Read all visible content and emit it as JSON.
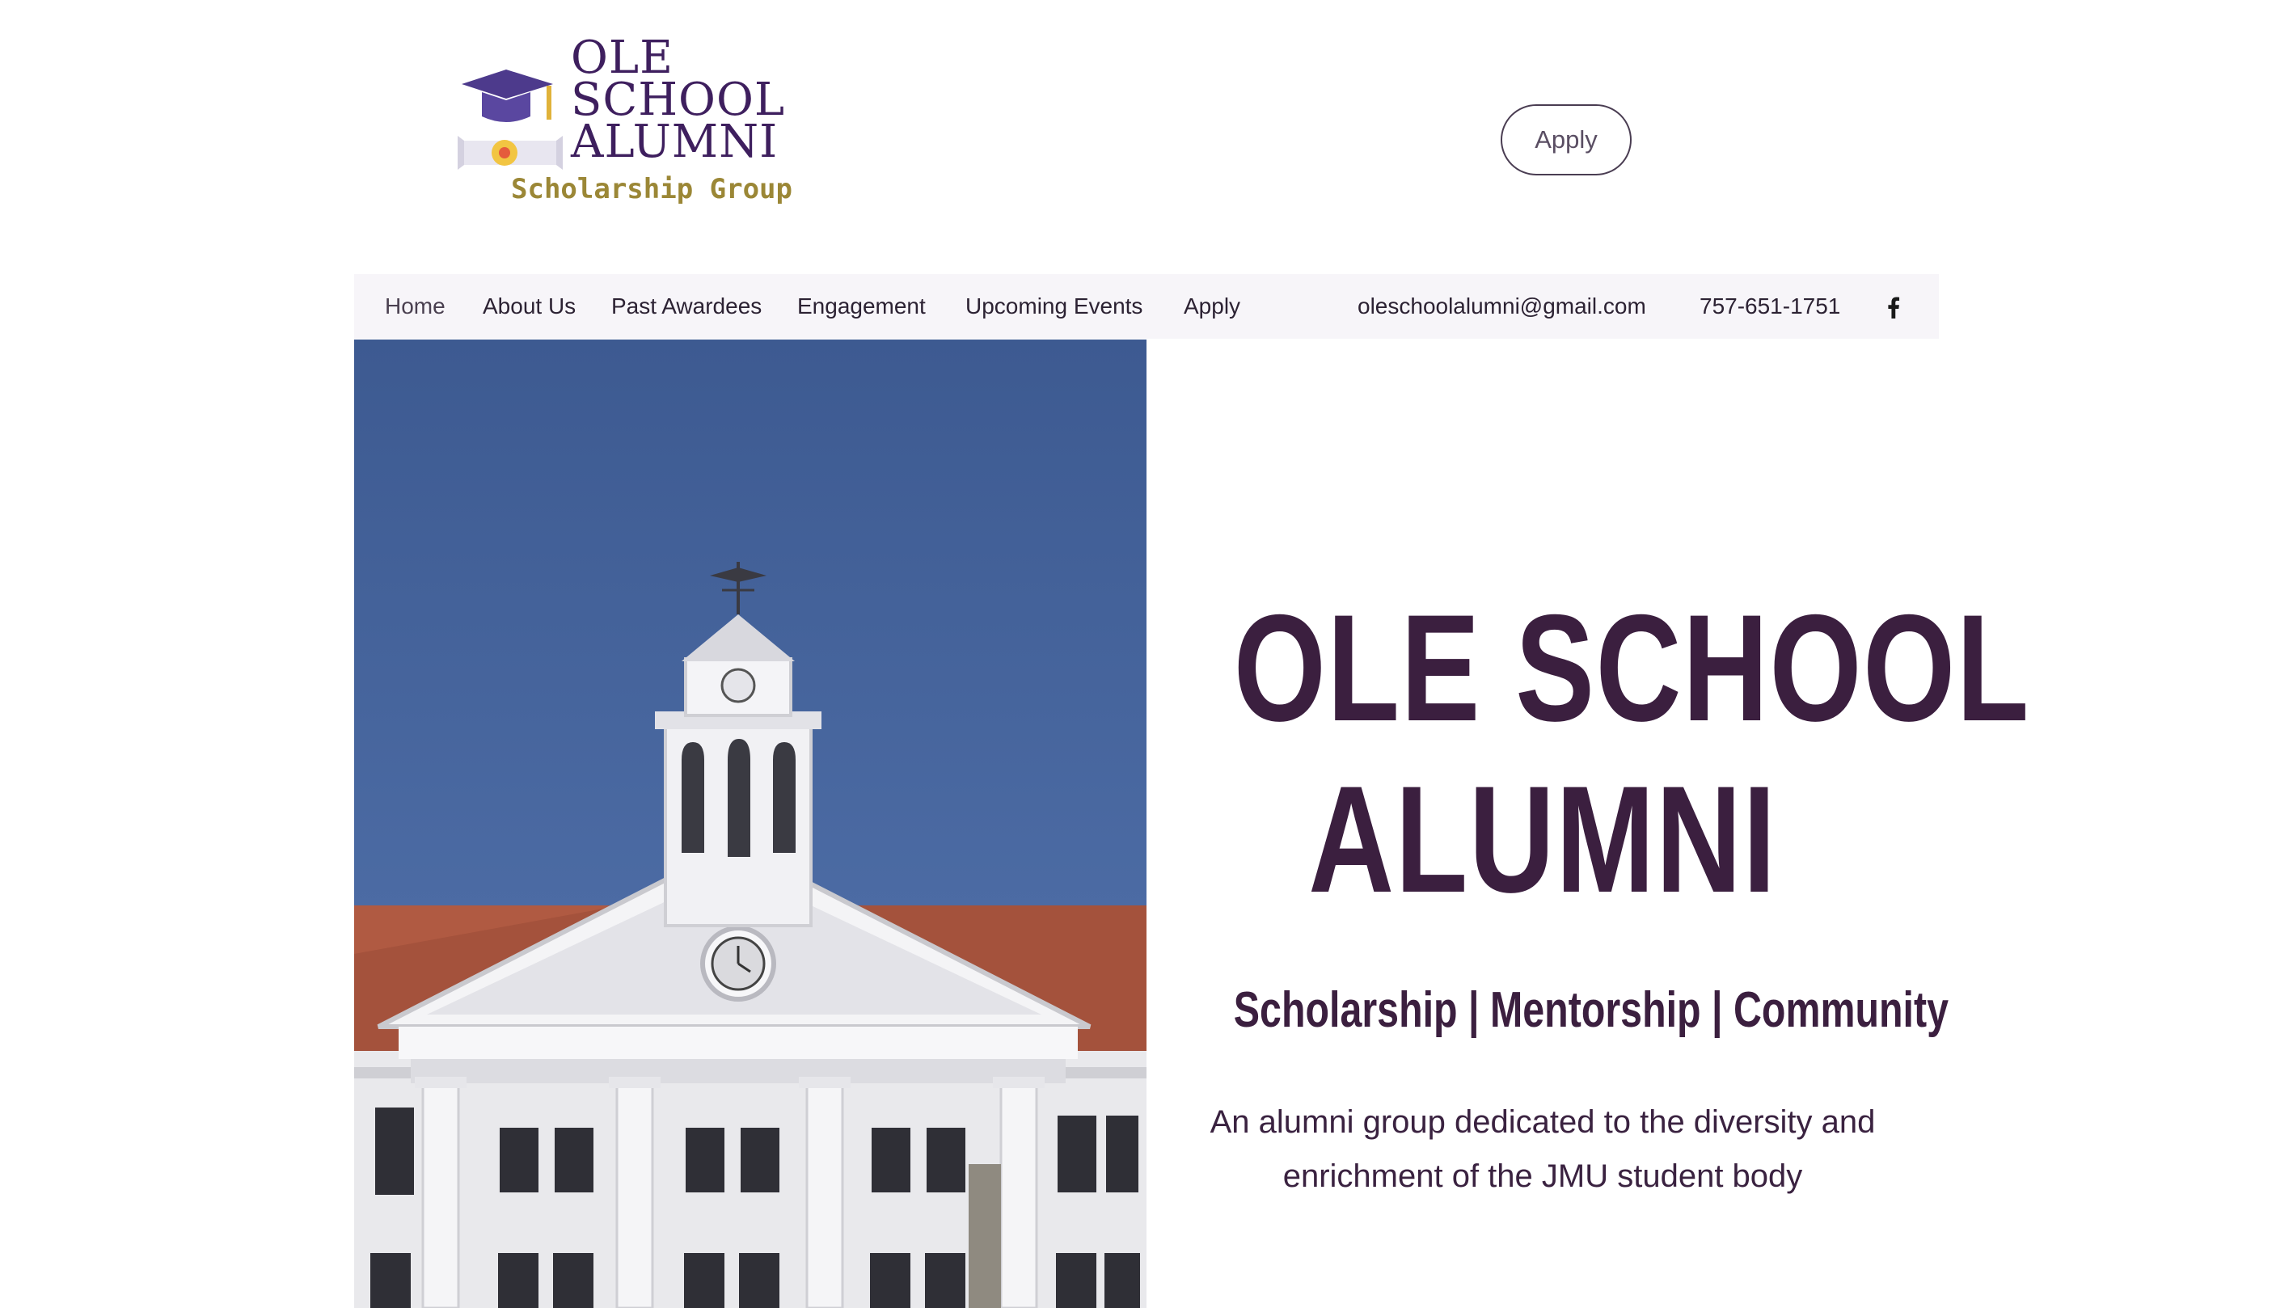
{
  "header": {
    "logo": {
      "title_lines": [
        "OLE",
        "SCHOOL",
        "ALUMNI"
      ],
      "subtitle": "Scholarship Group",
      "icon": "graduation-cap-diploma-icon"
    },
    "apply_button_label": "Apply"
  },
  "nav": {
    "items": [
      {
        "label": "Home",
        "active": true
      },
      {
        "label": "About Us"
      },
      {
        "label": "Past Awardees"
      },
      {
        "label": "Engagement"
      },
      {
        "label": "Upcoming Events"
      },
      {
        "label": "Apply"
      }
    ],
    "email": "oleschoolalumni@gmail.com",
    "phone": "757-651-1751",
    "social_icon": "facebook-icon"
  },
  "hero": {
    "image": "campus-clock-tower-building",
    "title_lines": [
      "OLE SCHOOL",
      "ALUMNI"
    ],
    "tagline": "Scholarship | Mentorship | Community",
    "description": "An alumni group dedicated to the diversity and enrichment of the JMU student body"
  },
  "colors": {
    "brand_purple": "#3b1f3f",
    "logo_purple": "#3e1f5e",
    "logo_gold": "#9b8736",
    "nav_background": "#f7f5f9",
    "sky_blue": "#4a6aa3"
  }
}
